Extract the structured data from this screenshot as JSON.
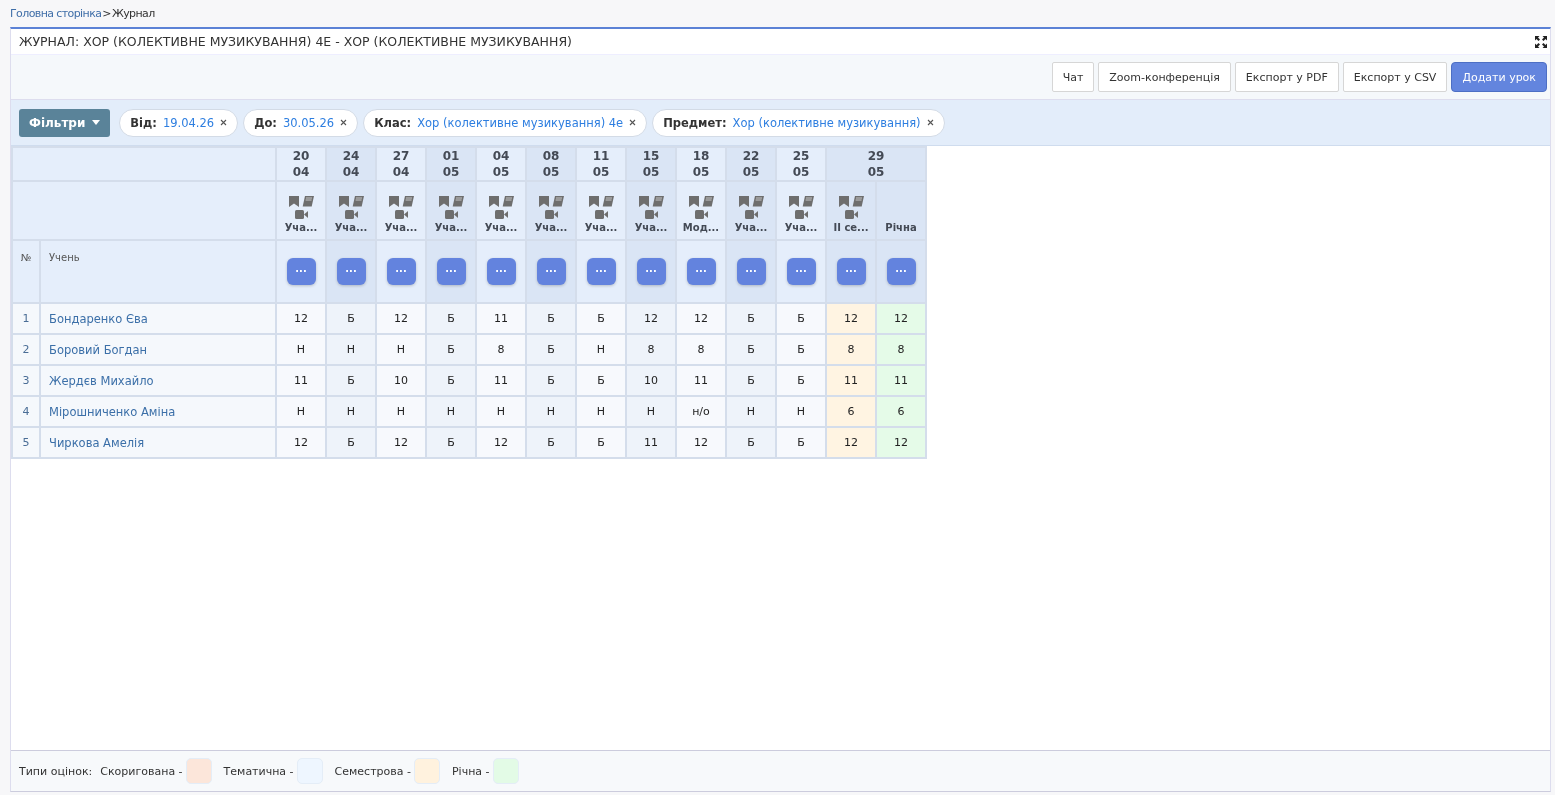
{
  "breadcrumb": [
    {
      "label": "Головна сторінка",
      "kind": "link"
    },
    {
      "label": ">",
      "kind": "separator"
    },
    {
      "label": "Журнал",
      "kind": "current"
    }
  ],
  "title": "ЖУРНАЛ: ХОР (КОЛЕКТИВНЕ МУЗИКУВАННЯ) 4Е - ХОР (КОЛЕКТИВНЕ МУЗИКУВАННЯ)",
  "toolbar_buttons": [
    {
      "label": "Чат",
      "primary": false
    },
    {
      "label": "Zoom-конференція",
      "primary": false
    },
    {
      "label": "Експорт у PDF",
      "primary": false
    },
    {
      "label": "Експорт у CSV",
      "primary": false
    },
    {
      "label": "Додати урок",
      "primary": true
    }
  ],
  "filters_button": "Фільтри",
  "filter_chips": [
    {
      "label": "Від:",
      "value": "19.04.26"
    },
    {
      "label": "До:",
      "value": "30.05.26"
    },
    {
      "label": "Клас:",
      "value": "Хор (колективне музикування) 4е"
    },
    {
      "label": "Предмет:",
      "value": "Хор (колективне музикування)"
    }
  ],
  "table": {
    "number_header": "№",
    "student_header": "Учень",
    "menu_label": "···",
    "dates": [
      {
        "day": "20",
        "month": "04",
        "columns": [
          {
            "kind": "lesson",
            "type": "Уча..."
          }
        ]
      },
      {
        "day": "24",
        "month": "04",
        "columns": [
          {
            "kind": "lesson",
            "type": "Уча..."
          }
        ]
      },
      {
        "day": "27",
        "month": "04",
        "columns": [
          {
            "kind": "lesson",
            "type": "Уча..."
          }
        ]
      },
      {
        "day": "01",
        "month": "05",
        "columns": [
          {
            "kind": "lesson",
            "type": "Уча..."
          }
        ]
      },
      {
        "day": "04",
        "month": "05",
        "columns": [
          {
            "kind": "lesson",
            "type": "Уча..."
          }
        ]
      },
      {
        "day": "08",
        "month": "05",
        "columns": [
          {
            "kind": "lesson",
            "type": "Уча..."
          }
        ]
      },
      {
        "day": "11",
        "month": "05",
        "columns": [
          {
            "kind": "lesson",
            "type": "Уча..."
          }
        ]
      },
      {
        "day": "15",
        "month": "05",
        "columns": [
          {
            "kind": "lesson",
            "type": "Уча..."
          }
        ]
      },
      {
        "day": "18",
        "month": "05",
        "columns": [
          {
            "kind": "lesson",
            "type": "Мод..."
          }
        ]
      },
      {
        "day": "22",
        "month": "05",
        "columns": [
          {
            "kind": "lesson",
            "type": "Уча..."
          }
        ]
      },
      {
        "day": "25",
        "month": "05",
        "columns": [
          {
            "kind": "lesson",
            "type": "Уча..."
          }
        ]
      },
      {
        "day": "29",
        "month": "05",
        "columns": [
          {
            "kind": "semester",
            "type": "II се..."
          },
          {
            "kind": "annual",
            "type": "Річна"
          }
        ]
      }
    ],
    "rows": [
      {
        "number": "1",
        "name": "Бондаренко Єва",
        "grades": [
          "12",
          "Б",
          "12",
          "Б",
          "11",
          "Б",
          "Б",
          "12",
          "12",
          "Б",
          "Б",
          "12",
          "12"
        ]
      },
      {
        "number": "2",
        "name": "Боровий Богдан",
        "grades": [
          "Н",
          "Н",
          "Н",
          "Б",
          "8",
          "Б",
          "Н",
          "8",
          "8",
          "Б",
          "Б",
          "8",
          "8"
        ]
      },
      {
        "number": "3",
        "name": "Жердєв Михайло",
        "grades": [
          "11",
          "Б",
          "10",
          "Б",
          "11",
          "Б",
          "Б",
          "10",
          "11",
          "Б",
          "Б",
          "11",
          "11"
        ]
      },
      {
        "number": "4",
        "name": "Мірошниченко Аміна",
        "grades": [
          "Н",
          "Н",
          "Н",
          "Н",
          "Н",
          "Н",
          "Н",
          "Н",
          "н/о",
          "Н",
          "Н",
          "6",
          "6"
        ]
      },
      {
        "number": "5",
        "name": "Чиркова Амелія",
        "grades": [
          "12",
          "Б",
          "12",
          "Б",
          "12",
          "Б",
          "Б",
          "11",
          "12",
          "Б",
          "Б",
          "12",
          "12"
        ]
      }
    ]
  },
  "legend": {
    "label": "Типи оцінок:",
    "items": [
      {
        "label": "Скоригована -",
        "color": "#fce6da"
      },
      {
        "label": "Тематична -",
        "color": "#eef6ff"
      },
      {
        "label": "Семестрова -",
        "color": "#fff2de"
      },
      {
        "label": "Річна -",
        "color": "#e3fbe6"
      }
    ]
  }
}
